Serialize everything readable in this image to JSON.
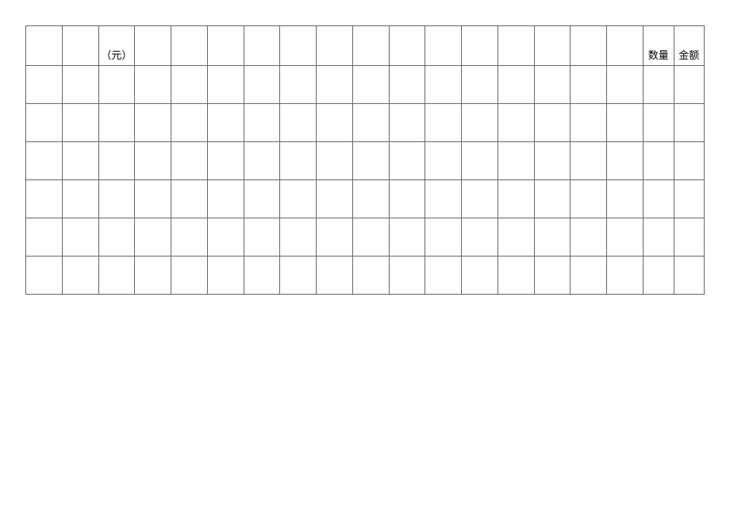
{
  "table": {
    "header": {
      "col3": "（元）",
      "col18": "数量",
      "col19": "金额"
    },
    "rows": 7,
    "cols": 19
  }
}
